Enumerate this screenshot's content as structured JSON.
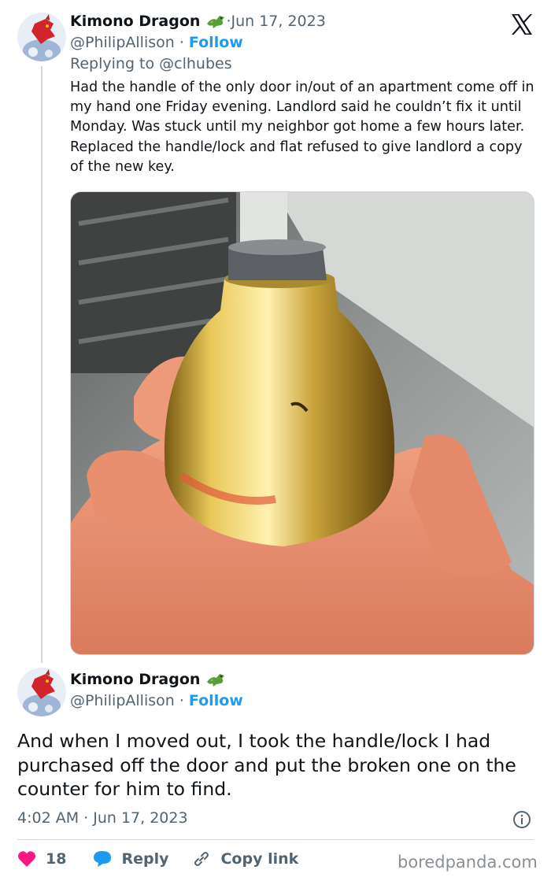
{
  "tweet1": {
    "name": "Kimono Dragon",
    "name_emoji_icon": "dragon-emoji",
    "date_sep": " · ",
    "date": "Jun 17, 2023",
    "handle": "@PhilipAllison",
    "handle_sep": " · ",
    "follow": "Follow",
    "replying_to": "Replying to @clhubes",
    "text": "Had the handle of the only door in/out of an apartment come off in my hand one Friday evening. Landlord said he couldn’t fix it until Monday. Was stuck until my neighbor got home a few hours later. Replaced the handle/lock and flat refused to give landlord a copy of the new key."
  },
  "tweet2": {
    "name": "Kimono Dragon",
    "name_emoji_icon": "dragon-emoji",
    "handle": "@PhilipAllison",
    "handle_sep": " · ",
    "follow": "Follow",
    "text": "And when I moved out, I took the handle/lock I had purchased off the door and put the broken one on the counter for him to find.",
    "timestamp": "4:02 AM · Jun 17, 2023"
  },
  "actions": {
    "like_count": "18",
    "reply_label": "Reply",
    "copy_link_label": "Copy link"
  },
  "watermark": "boredpanda.com",
  "colors": {
    "link_blue": "#1d9bf0",
    "like_pink": "#f91880",
    "secondary_text": "#536471"
  }
}
